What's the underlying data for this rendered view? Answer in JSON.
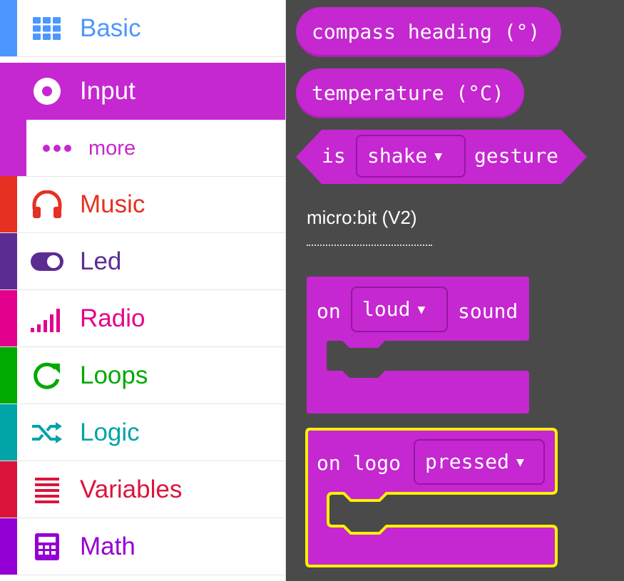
{
  "toolbox": {
    "categories": [
      {
        "label": "Basic",
        "color": "#4c97ff",
        "icon": "grid-icon"
      },
      {
        "label": "Input",
        "color": "#c527d1",
        "icon": "target-icon",
        "selected": true
      },
      {
        "label": "more",
        "color": "#c527d1",
        "icon": "ellipsis-icon",
        "sub": true
      },
      {
        "label": "Music",
        "color": "#e63022",
        "icon": "headphones-icon"
      },
      {
        "label": "Led",
        "color": "#5c2d91",
        "icon": "toggle-icon"
      },
      {
        "label": "Radio",
        "color": "#e3008c",
        "icon": "signal-bars-icon"
      },
      {
        "label": "Loops",
        "color": "#00aa00",
        "icon": "refresh-icon"
      },
      {
        "label": "Logic",
        "color": "#00a4a6",
        "icon": "shuffle-icon"
      },
      {
        "label": "Variables",
        "color": "#dc143c",
        "icon": "list-lines-icon"
      },
      {
        "label": "Math",
        "color": "#9400d3",
        "icon": "calculator-icon"
      }
    ]
  },
  "blocks": {
    "compass": "compass heading (°)",
    "temperature": "temperature (°C)",
    "gesture": {
      "prefix": "is",
      "value": "shake",
      "suffix": "gesture"
    },
    "section_title": "micro:bit (V2)",
    "sound_event": {
      "prefix": "on",
      "value": "loud",
      "suffix": "sound"
    },
    "logo_event": {
      "prefix": "on logo",
      "value": "pressed"
    }
  },
  "colors": {
    "input_block": "#c527d1",
    "highlight": "#fff200",
    "workspace": "#4a4a4a"
  }
}
